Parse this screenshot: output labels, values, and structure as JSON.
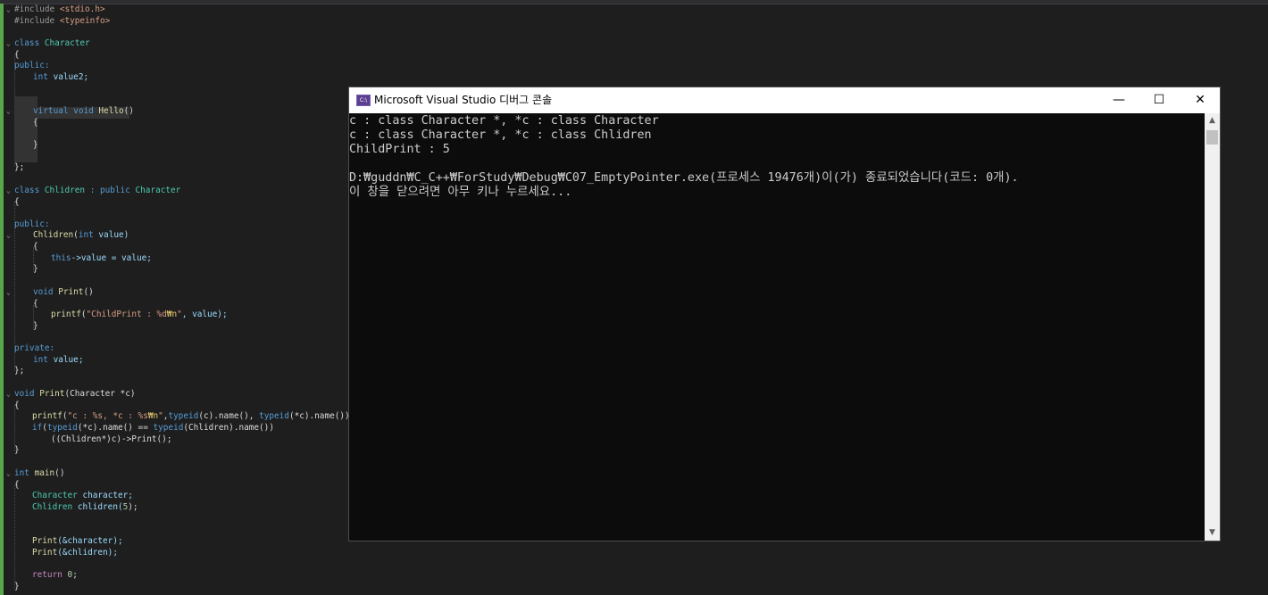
{
  "console": {
    "title": "Microsoft Visual Studio 디버그 콘솔",
    "icon_text": "C:\\",
    "buttons": {
      "minimize": "—",
      "maximize": "☐",
      "close": "✕"
    },
    "lines": [
      "c : class Character *, *c : class Character",
      "c : class Character *, *c : class Chlidren",
      "ChildPrint : 5",
      "",
      "D:₩guddn₩C_C++₩ForStudy₩Debug₩C07_EmptyPointer.exe(프로세스 19476개)이(가) 종료되었습니다(코드: 0개).",
      "이 창을 닫으려면 아무 키나 누르세요..."
    ],
    "scrollbar": {
      "up": "▲",
      "down": "▼"
    }
  },
  "editor": {
    "code": {
      "l0a": "#include ",
      "l0b": "<stdio.h>",
      "l1a": "#include ",
      "l1b": "<typeinfo>",
      "kw_class": "class",
      "t_character": "Character",
      "brace_open": "{",
      "brace_close": "}",
      "brace_close_semi": "};",
      "kw_public": "public:",
      "kw_private": "private:",
      "kw_int": "int",
      "v_value2": "value2;",
      "kw_virtual": "virtual",
      "kw_void": "void",
      "f_hello": "Hello",
      "parens": "()",
      "t_chlidren": "Chlidren",
      "colon_public": " : public ",
      "f_chlidren": "Chlidren",
      "p_open": "(",
      "p_int_value": "value)",
      "kw_this": "this",
      "arrow_value": "->value = ",
      "v_value_semi": "value;",
      "f_print": "Print",
      "f_printf": "printf",
      "s_childprint": "\"ChildPrint : %d",
      "s_esc": "₩n",
      "s_q": "\"",
      "rest_value": ", value);",
      "v_value": "value;",
      "print_sig_a": "(Character *c)",
      "s_fmt": "\"c : %s, *c : %s",
      "typeid": "typeid",
      "c_name": "(c).name(), ",
      "star_c_name": "(*c).name());",
      "kw_if": "if",
      "if_a": "(",
      "if_b": "(*c).name() == ",
      "if_c": "(Chlidren).name())",
      "cast_line": "((Chlidren*)c)->Print();",
      "f_main": "main",
      "v_character": "character;",
      "v_chlidren5a": "chlidren(",
      "v_num5": "5",
      "v_chlidren5b": ");",
      "call_char": "(&character);",
      "call_chl": "(&chlidren);",
      "kw_return": "return",
      "ret_zero": "0",
      "semi": ";",
      "fold_open": "⌄"
    }
  }
}
